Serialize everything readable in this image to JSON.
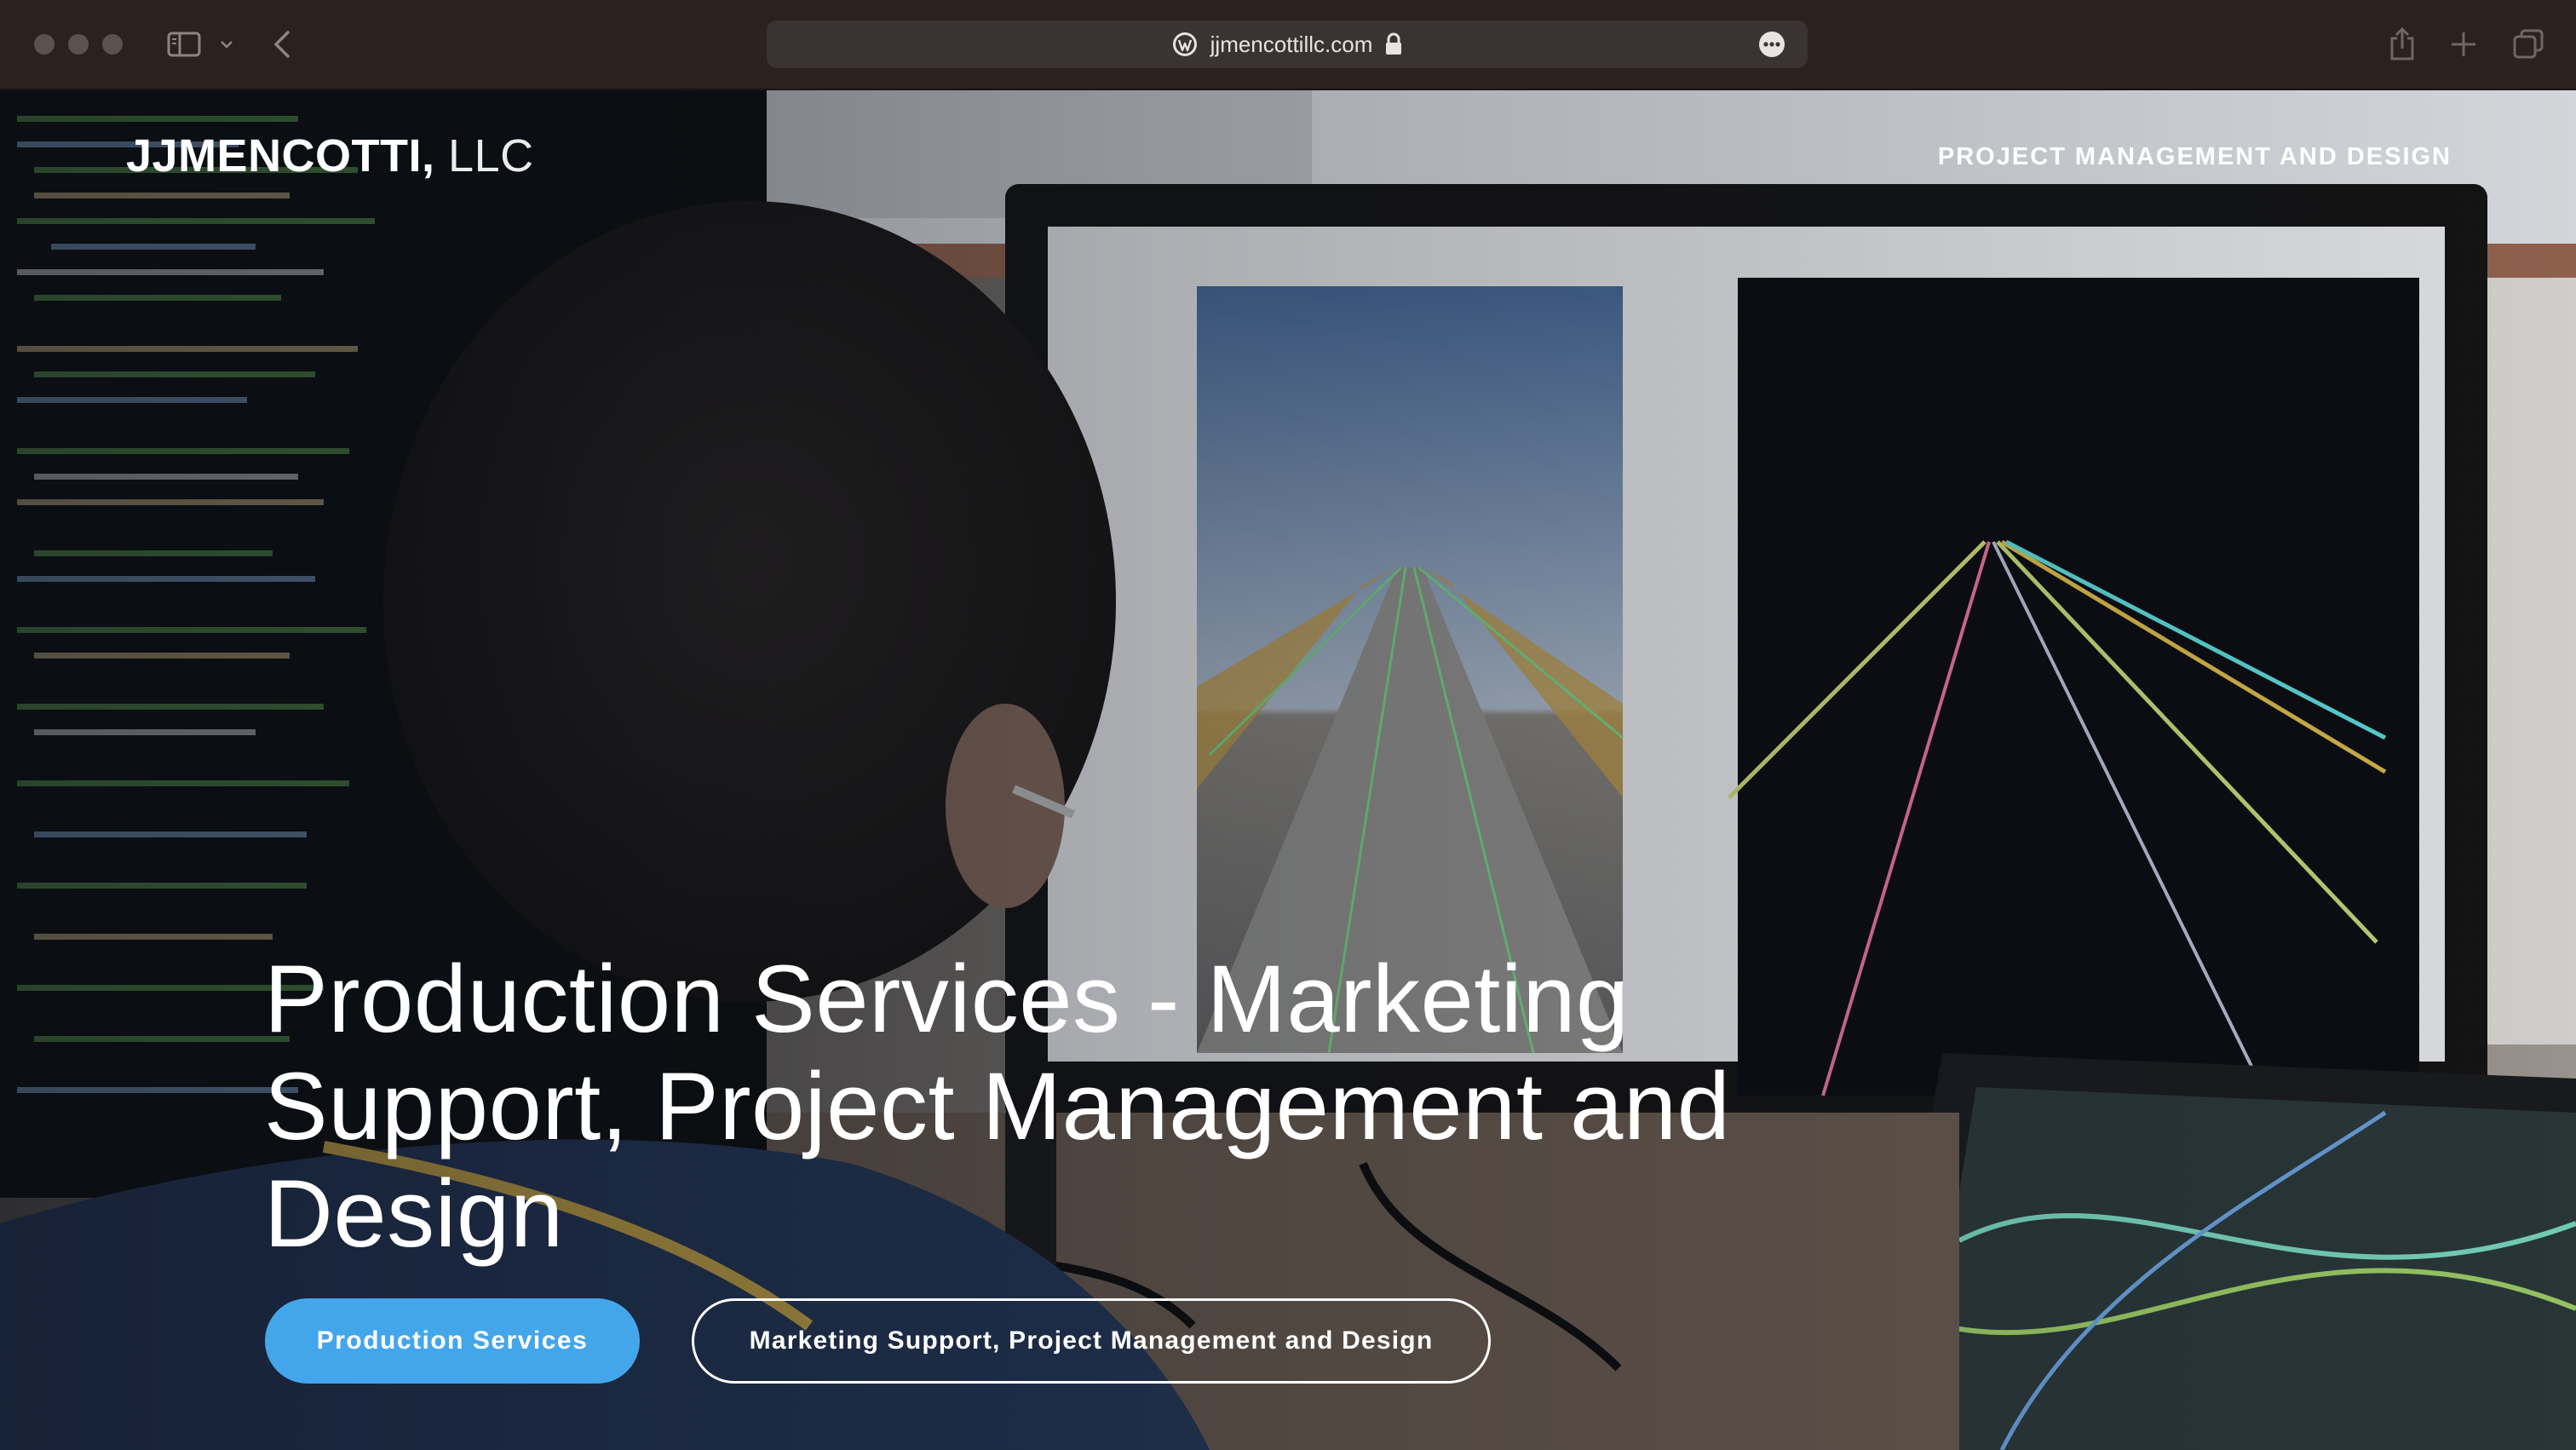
{
  "browser": {
    "url": "jjmencottillc.com",
    "icons": {
      "sidebar": "sidebar-icon",
      "chevron": "chevron-down-icon",
      "back": "back-arrow-icon",
      "site": "wordpress-icon",
      "lock": "lock-icon",
      "more": "ellipsis-icon",
      "share": "share-icon",
      "new_tab": "plus-icon",
      "tabs": "tab-overview-icon"
    }
  },
  "site": {
    "logo_bold": "JJMENCOTTI,",
    "logo_light": " LLC",
    "nav_link": "PROJECT MANAGEMENT AND DESIGN",
    "headline": "Production Services - Marketing Support, Project Management and Design",
    "primary_button": "Production Services",
    "secondary_button": "Marketing Support, Project Management and Design"
  },
  "colors": {
    "accent": "#44a6ea",
    "chrome": "#2b2220",
    "text": "#ffffff"
  }
}
